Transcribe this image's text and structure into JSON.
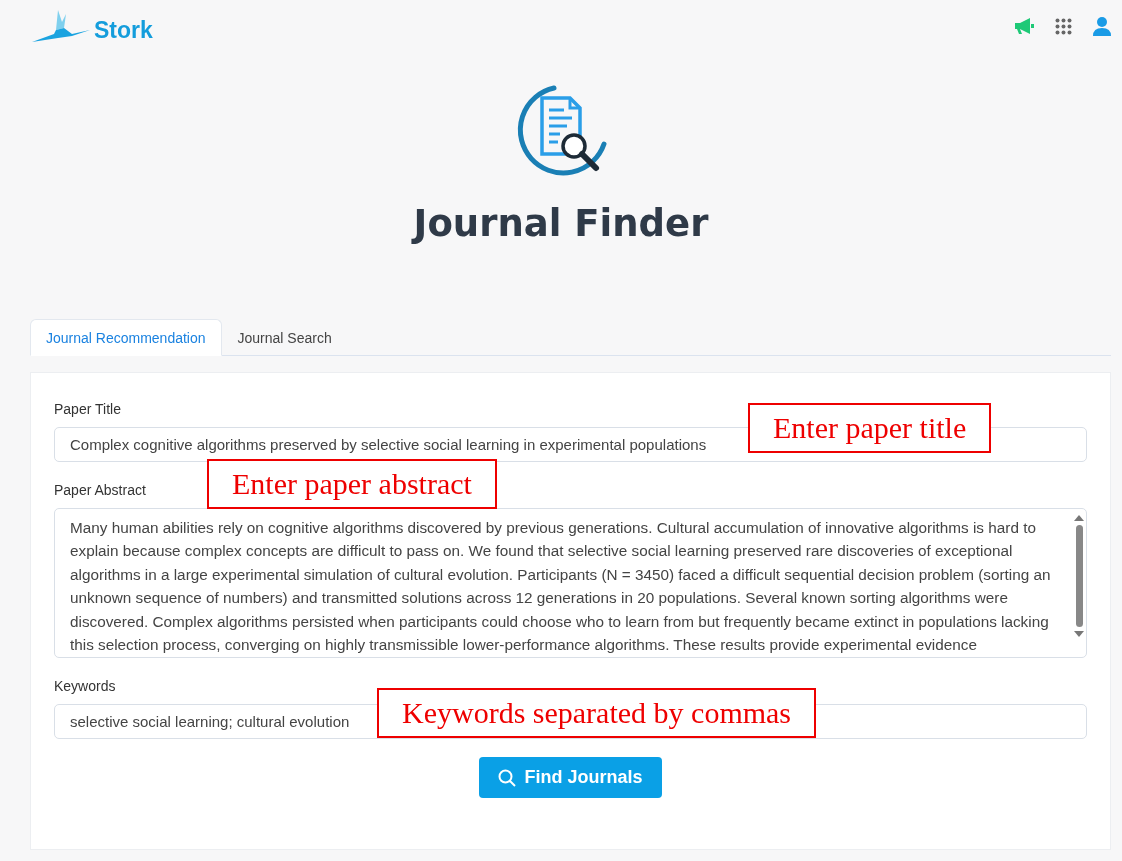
{
  "header": {
    "logo": "Stork"
  },
  "page": {
    "title": "Journal Finder"
  },
  "tabs": [
    {
      "label": "Journal Recommendation",
      "selected": true
    },
    {
      "label": "Journal Search",
      "selected": false
    }
  ],
  "form": {
    "fields": [
      {
        "kind": "input",
        "label": "Paper Title",
        "value": "Complex cognitive algorithms preserved by selective social learning in experimental populations"
      },
      {
        "kind": "textarea",
        "label": "Paper Abstract",
        "value": "Many human abilities rely on cognitive algorithms discovered by previous generations. Cultural accumulation of innovative algorithms is hard to explain because complex concepts are difficult to pass on. We found that selective social learning preserved rare discoveries of exceptional algorithms in a large experimental simulation of cultural evolution. Participants (N = 3450) faced a difficult sequential decision problem (sorting an unknown sequence of numbers) and transmitted solutions across 12 generations in 20 populations. Several known sorting algorithms were discovered. Complex algorithms persisted when participants could choose who to learn from but frequently became extinct in populations lacking this selection process, converging on highly transmissible lower-performance algorithms. These results provide experimental evidence"
      },
      {
        "kind": "input",
        "label": "Keywords",
        "value": "selective social learning; cultural evolution"
      }
    ],
    "submit": "Find Journals"
  },
  "annotations": [
    "Enter paper title",
    "Enter paper abstract",
    "Keywords separated by commas"
  ]
}
